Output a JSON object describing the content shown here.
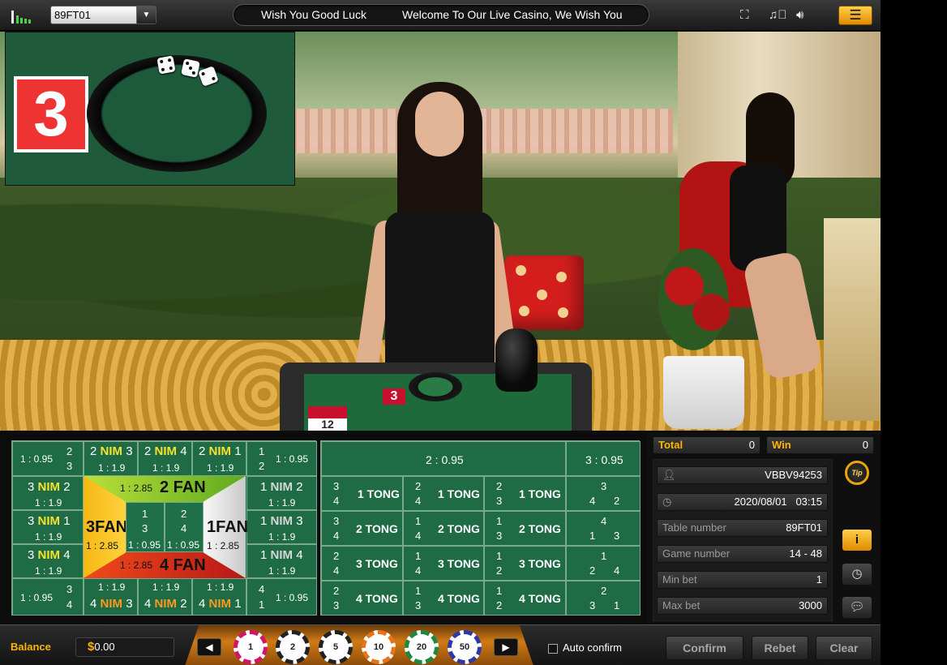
{
  "header": {
    "table_select": "89FT01",
    "marquee": [
      "Wish You Good Luck",
      "Welcome To Our Live Casino, We Wish You"
    ]
  },
  "result": {
    "number": "3"
  },
  "board_left": {
    "c1": {
      "odds": "1 : 0.95",
      "a": "2",
      "b": "3"
    },
    "c2": {
      "n1": "2",
      "nim": "NIM",
      "n2": "3",
      "odds": "1 : 1.9"
    },
    "c3": {
      "n1": "2",
      "nim": "NIM",
      "n2": "4",
      "odds": "1 : 1.9"
    },
    "c4": {
      "n1": "2",
      "nim": "NIM",
      "n2": "1",
      "odds": "1 : 1.9"
    },
    "c5": {
      "a": "1",
      "b": "2",
      "odds": "1 : 0.95"
    },
    "l1": {
      "n1": "3",
      "nim": "NIM",
      "n2": "2",
      "odds": "1 : 1.9"
    },
    "l2": {
      "n1": "3",
      "nim": "NIM",
      "n2": "1",
      "odds": "1 : 1.9"
    },
    "l3": {
      "n1": "3",
      "nim": "NIM",
      "n2": "4",
      "odds": "1 : 1.9"
    },
    "r1": {
      "n1": "1",
      "nim": "NIM",
      "n2": "2",
      "odds": "1 : 1.9"
    },
    "r2": {
      "n1": "1",
      "nim": "NIM",
      "n2": "3",
      "odds": "1 : 1.9"
    },
    "r3": {
      "n1": "1",
      "nim": "NIM",
      "n2": "4",
      "odds": "1 : 1.9"
    },
    "b1": {
      "odds": "1 : 0.95",
      "a": "3",
      "b": "4"
    },
    "b2": {
      "odds": "1 : 1.9",
      "n1": "4",
      "nim": "NIM",
      "n2": "3"
    },
    "b3": {
      "odds": "1 : 1.9",
      "n1": "4",
      "nim": "NIM",
      "n2": "2"
    },
    "b4": {
      "odds": "1 : 1.9",
      "n1": "4",
      "nim": "NIM",
      "n2": "1"
    },
    "b5": {
      "a": "4",
      "b": "1",
      "odds": "1 : 0.95"
    },
    "fan2": {
      "odds": "1 : 2.85",
      "label": "2 FAN"
    },
    "fan4": {
      "odds": "1 : 2.85",
      "label": "4 FAN"
    },
    "fan3": {
      "label": "3FAN",
      "odds": "1 : 2.85"
    },
    "fan1": {
      "label": "1FAN",
      "odds": "1 : 2.85"
    },
    "mid1": {
      "a": "1",
      "b": "3",
      "odds": "1 : 0.95"
    },
    "mid2": {
      "a": "2",
      "b": "4",
      "odds": "1 : 0.95"
    }
  },
  "board_right": {
    "header_a": "2 : 0.95",
    "header_b": "3 : 0.95",
    "rows": [
      [
        {
          "a": "3",
          "b": "4",
          "label": "1 TONG"
        },
        {
          "a": "2",
          "b": "4",
          "label": "1 TONG"
        },
        {
          "a": "2",
          "b": "3",
          "label": "1 TONG"
        },
        {
          "t": "3",
          "l": "4",
          "r": "2"
        }
      ],
      [
        {
          "a": "3",
          "b": "4",
          "label": "2 TONG"
        },
        {
          "a": "1",
          "b": "4",
          "label": "2 TONG"
        },
        {
          "a": "1",
          "b": "3",
          "label": "2 TONG"
        },
        {
          "t": "4",
          "l": "1",
          "r": "3"
        }
      ],
      [
        {
          "a": "2",
          "b": "4",
          "label": "3 TONG"
        },
        {
          "a": "1",
          "b": "4",
          "label": "3 TONG"
        },
        {
          "a": "1",
          "b": "2",
          "label": "3 TONG"
        },
        {
          "t": "1",
          "l": "2",
          "r": "4"
        }
      ],
      [
        {
          "a": "2",
          "b": "3",
          "label": "4 TONG"
        },
        {
          "a": "1",
          "b": "3",
          "label": "4 TONG"
        },
        {
          "a": "1",
          "b": "2",
          "label": "4 TONG"
        },
        {
          "t": "2",
          "l": "3",
          "r": "1"
        }
      ]
    ]
  },
  "panel": {
    "total_label": "Total",
    "total_value": "0",
    "win_label": "Win",
    "win_value": "0",
    "user": "VBBV94253",
    "date": "2020/08/01",
    "time": "03:15",
    "table_label": "Table number",
    "table_value": "89FT01",
    "game_label": "Game number",
    "game_value": "14 - 48",
    "min_label": "Min bet",
    "min_value": "1",
    "max_label": "Max bet",
    "max_value": "3000",
    "tip_label": "Tip"
  },
  "bottom": {
    "balance_label": "Balance",
    "balance_symbol": "$",
    "balance_value": "0.00",
    "chips": [
      "1",
      "2",
      "5",
      "10",
      "20",
      "50"
    ],
    "auto_confirm": "Auto confirm",
    "confirm": "Confirm",
    "rebet": "Rebet",
    "clear": "Clear"
  },
  "colors": {
    "accent": "#ffb400",
    "felt": "#1e6b46",
    "nim_yellow": "#f6e22f",
    "nim_orange": "#ff9a1e"
  }
}
